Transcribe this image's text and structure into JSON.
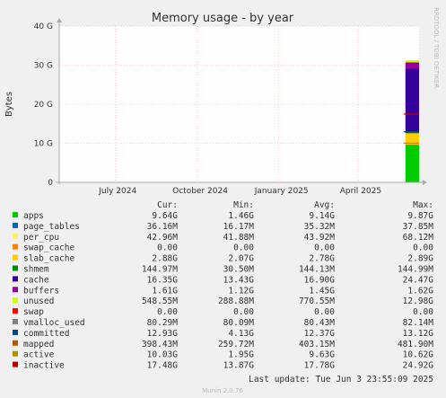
{
  "chart_data": {
    "type": "area",
    "title": "Memory usage - by year",
    "ylabel": "Bytes",
    "ylim": [
      0,
      40
    ],
    "y_unit": "G",
    "y_ticks": [
      {
        "v": 0,
        "label": "0"
      },
      {
        "v": 10,
        "label": "10 G"
      },
      {
        "v": 20,
        "label": "20 G"
      },
      {
        "v": 30,
        "label": "30 G"
      },
      {
        "v": 40,
        "label": "40 G"
      }
    ],
    "x_ticks": [
      {
        "pos": 0.225,
        "label": "July 2024"
      },
      {
        "pos": 0.454,
        "label": "October 2024"
      },
      {
        "pos": 0.68,
        "label": "January 2025"
      },
      {
        "pos": 0.9,
        "label": "April 2025"
      }
    ],
    "grid": true,
    "data_span": {
      "start": 0.962,
      "end": 1.0
    },
    "series": [
      {
        "name": "apps",
        "color": "#00cc00",
        "value": 9.64
      },
      {
        "name": "page_tables",
        "color": "#0066b3",
        "value": 0.036
      },
      {
        "name": "per_cpu",
        "color": "#ff8000",
        "value": 0.043
      },
      {
        "name": "swap_cache",
        "color": "#ffcc00",
        "value": 0.0
      },
      {
        "name": "slab_cache",
        "color": "#ffcc00",
        "value": 2.88
      },
      {
        "name": "shmem",
        "color": "#008f00",
        "value": 0.145
      },
      {
        "name": "cache",
        "color": "#330099",
        "value": 16.35
      },
      {
        "name": "buffers",
        "color": "#990099",
        "value": 1.61
      },
      {
        "name": "unused",
        "color": "#ccff00",
        "value": 0.549
      }
    ],
    "lines": [
      {
        "name": "inactive",
        "color": "#cc0000",
        "value": 17.48
      },
      {
        "name": "active",
        "color": "#b38f00",
        "value": 10.03
      },
      {
        "name": "committed",
        "color": "#00487d",
        "value": 12.93
      }
    ]
  },
  "side_label": "RRDTOOL / TOBI OETIKER",
  "legend": {
    "headers": [
      "Cur:",
      "Min:",
      "Avg:",
      "Max:"
    ],
    "rows": [
      {
        "name": "apps",
        "color": "#00cc00",
        "cur": "9.64G",
        "min": "1.46G",
        "avg": "9.14G",
        "max": "9.87G"
      },
      {
        "name": "page_tables",
        "color": "#0066b3",
        "cur": "36.16M",
        "min": "16.17M",
        "avg": "35.32M",
        "max": "37.85M"
      },
      {
        "name": "per_cpu",
        "color": "#ffee66",
        "cur": "42.96M",
        "min": "41.88M",
        "avg": "43.92M",
        "max": "68.12M"
      },
      {
        "name": "swap_cache",
        "color": "#ff8000",
        "cur": "0.00",
        "min": "0.00",
        "avg": "0.00",
        "max": "0.00"
      },
      {
        "name": "slab_cache",
        "color": "#ffcc00",
        "cur": "2.88G",
        "min": "2.07G",
        "avg": "2.78G",
        "max": "2.89G"
      },
      {
        "name": "shmem",
        "color": "#008f00",
        "cur": "144.97M",
        "min": "30.50M",
        "avg": "144.13M",
        "max": "144.99M"
      },
      {
        "name": "cache",
        "color": "#330099",
        "cur": "16.35G",
        "min": "13.43G",
        "avg": "16.90G",
        "max": "24.47G"
      },
      {
        "name": "buffers",
        "color": "#990099",
        "cur": "1.61G",
        "min": "1.12G",
        "avg": "1.45G",
        "max": "1.62G"
      },
      {
        "name": "unused",
        "color": "#ccff00",
        "cur": "548.55M",
        "min": "288.88M",
        "avg": "770.55M",
        "max": "12.98G"
      },
      {
        "name": "swap",
        "color": "#ff0000",
        "cur": "0.00",
        "min": "0.00",
        "avg": "0.00",
        "max": "0.00"
      },
      {
        "name": "vmalloc_used",
        "color": "#808080",
        "cur": "80.29M",
        "min": "80.09M",
        "avg": "80.43M",
        "max": "82.14M"
      },
      {
        "name": "committed",
        "color": "#00487d",
        "cur": "12.93G",
        "min": "4.13G",
        "avg": "12.37G",
        "max": "13.12G"
      },
      {
        "name": "mapped",
        "color": "#b35a00",
        "cur": "398.43M",
        "min": "259.72M",
        "avg": "403.15M",
        "max": "481.90M"
      },
      {
        "name": "active",
        "color": "#b38f00",
        "cur": "10.03G",
        "min": "1.95G",
        "avg": "9.63G",
        "max": "10.62G"
      },
      {
        "name": "inactive",
        "color": "#b30000",
        "cur": "17.48G",
        "min": "13.87G",
        "avg": "17.78G",
        "max": "24.92G"
      }
    ]
  },
  "last_update": "Last update: Tue Jun  3 23:55:09 2025",
  "footer": "Munin 2.0.76"
}
